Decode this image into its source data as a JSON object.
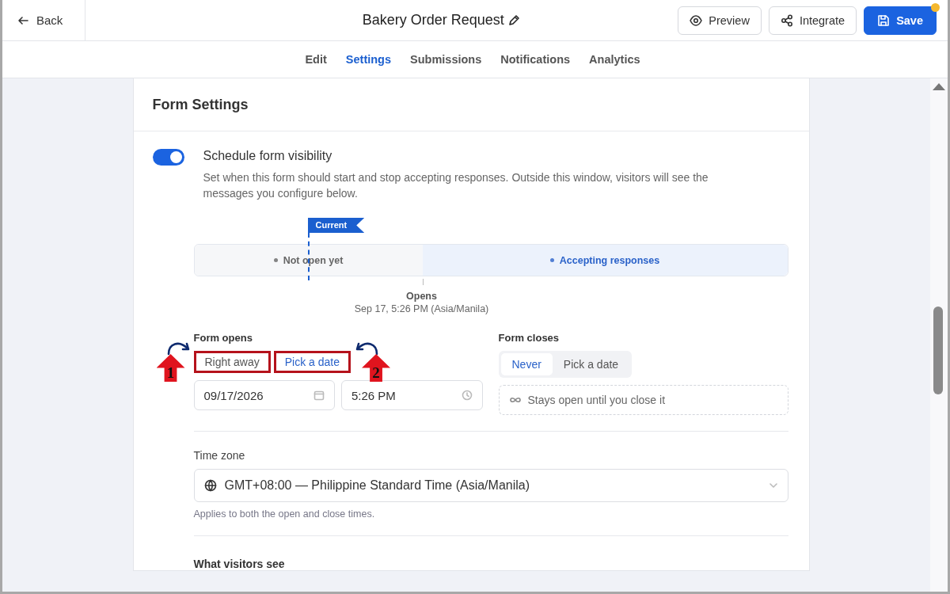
{
  "header": {
    "back": "Back",
    "title": "Bakery Order Request",
    "actions": [
      {
        "label": "Preview",
        "kind": "preview",
        "notification": false
      },
      {
        "label": "Integrate",
        "kind": "integrate",
        "notification": false
      },
      {
        "label": "Save",
        "kind": "save",
        "notification": true
      }
    ]
  },
  "tabs": [
    {
      "label": "Edit",
      "selected": false
    },
    {
      "label": "Settings",
      "selected": true
    },
    {
      "label": "Submissions",
      "selected": false
    },
    {
      "label": "Notifications",
      "selected": false
    },
    {
      "label": "Analytics",
      "selected": false
    }
  ],
  "card": {
    "title": "Form Settings",
    "schedule": {
      "on": true,
      "title": "Schedule form visibility",
      "description": "Set when this form should start and stop accepting responses. Outside this window, visitors will see the messages you configure below."
    },
    "timeline": {
      "marker": "Current",
      "segments": [
        {
          "label": "Not open yet",
          "selected": false
        },
        {
          "label": "Accepting responses",
          "selected": true
        }
      ],
      "boundary_label": "Opens",
      "boundary_time": "Sep 17, 5:26 PM (Asia/Manila)"
    },
    "opens": {
      "label": "Form opens",
      "options": [
        {
          "label": "Right away",
          "selected": false,
          "annotation": {
            "number": "1",
            "kind": "left"
          }
        },
        {
          "label": "Pick a date",
          "selected": true,
          "annotation": {
            "number": "2",
            "kind": "right"
          }
        }
      ],
      "date": "09/17/2026",
      "time": "5:26 PM"
    },
    "closes": {
      "label": "Form closes",
      "options": [
        {
          "label": "Never",
          "selected": true
        },
        {
          "label": "Pick a date",
          "selected": false
        }
      ],
      "note": "Stays open until you close it"
    },
    "timezone": {
      "label": "Time zone",
      "value": "GMT+08:00 — Philippine Standard Time (Asia/Manila)",
      "hint": "Applies to both the open and close times."
    },
    "visitors": {
      "title": "What visitors see"
    }
  }
}
